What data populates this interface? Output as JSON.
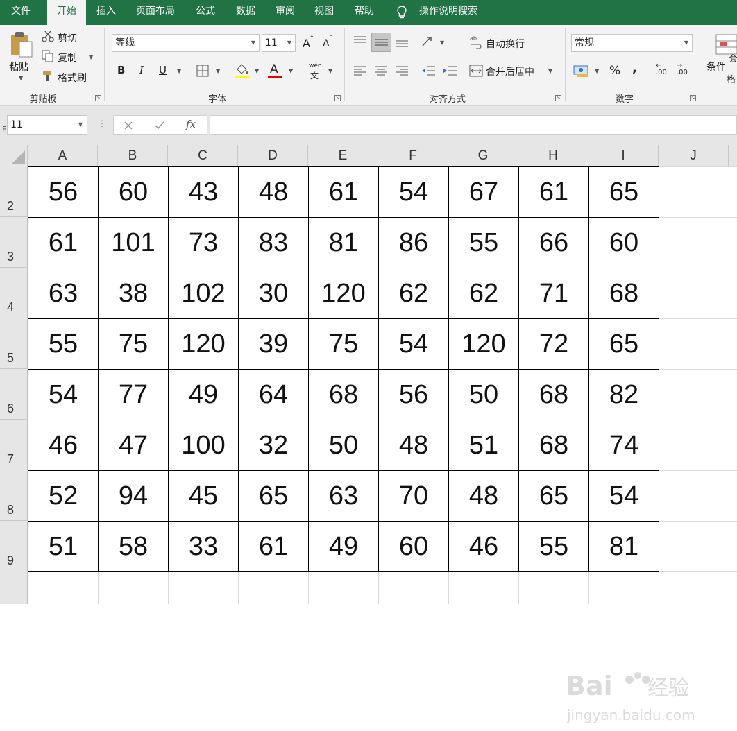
{
  "menu": {
    "tabs": [
      "文件",
      "开始",
      "插入",
      "页面布局",
      "公式",
      "数据",
      "审阅",
      "视图",
      "帮助"
    ],
    "tell_me": "操作说明搜索"
  },
  "ribbon": {
    "clipboard": {
      "paste": "粘贴",
      "cut": "剪切",
      "copy": "复制",
      "format_painter": "格式刷",
      "label": "剪贴板"
    },
    "font": {
      "name": "等线",
      "size": "11",
      "bold": "B",
      "italic": "I",
      "underline": "U",
      "phonetic": "wén",
      "grow": "A",
      "shrink": "A",
      "font_color_letter": "A",
      "label": "字体"
    },
    "alignment": {
      "wrap": "自动换行",
      "merge": "合并后居中",
      "label": "对齐方式"
    },
    "number": {
      "format": "常规",
      "percent": "%",
      "comma": ",",
      "inc_decimal": ".00",
      "dec_decimal": ".00",
      "label": "数字"
    },
    "styles": {
      "conditional": "条件",
      "format_table_partial": "格",
      "cell_partial": "套"
    },
    "accent": "#217346"
  },
  "formula_bar": {
    "name_box": "11",
    "name_box_prefix": "F",
    "fx": "fx"
  },
  "sheet": {
    "columns": [
      "A",
      "B",
      "C",
      "D",
      "E",
      "F",
      "G",
      "H",
      "I",
      "J"
    ],
    "rows": [
      "2",
      "3",
      "4",
      "5",
      "6",
      "7",
      "8",
      "9"
    ],
    "data": [
      [
        "56",
        "60",
        "43",
        "48",
        "61",
        "54",
        "67",
        "61",
        "65"
      ],
      [
        "61",
        "101",
        "73",
        "83",
        "81",
        "86",
        "55",
        "66",
        "60"
      ],
      [
        "63",
        "38",
        "102",
        "30",
        "120",
        "62",
        "62",
        "71",
        "68"
      ],
      [
        "55",
        "75",
        "120",
        "39",
        "75",
        "54",
        "120",
        "72",
        "65"
      ],
      [
        "54",
        "77",
        "49",
        "64",
        "68",
        "56",
        "50",
        "68",
        "82"
      ],
      [
        "46",
        "47",
        "100",
        "32",
        "50",
        "48",
        "51",
        "68",
        "74"
      ],
      [
        "52",
        "94",
        "45",
        "65",
        "63",
        "70",
        "48",
        "65",
        "54"
      ],
      [
        "51",
        "58",
        "33",
        "61",
        "49",
        "60",
        "46",
        "55",
        "81"
      ]
    ]
  },
  "watermark": {
    "brand": "Bai",
    "brand2": "经验",
    "url": "jingyan.baidu.com"
  }
}
